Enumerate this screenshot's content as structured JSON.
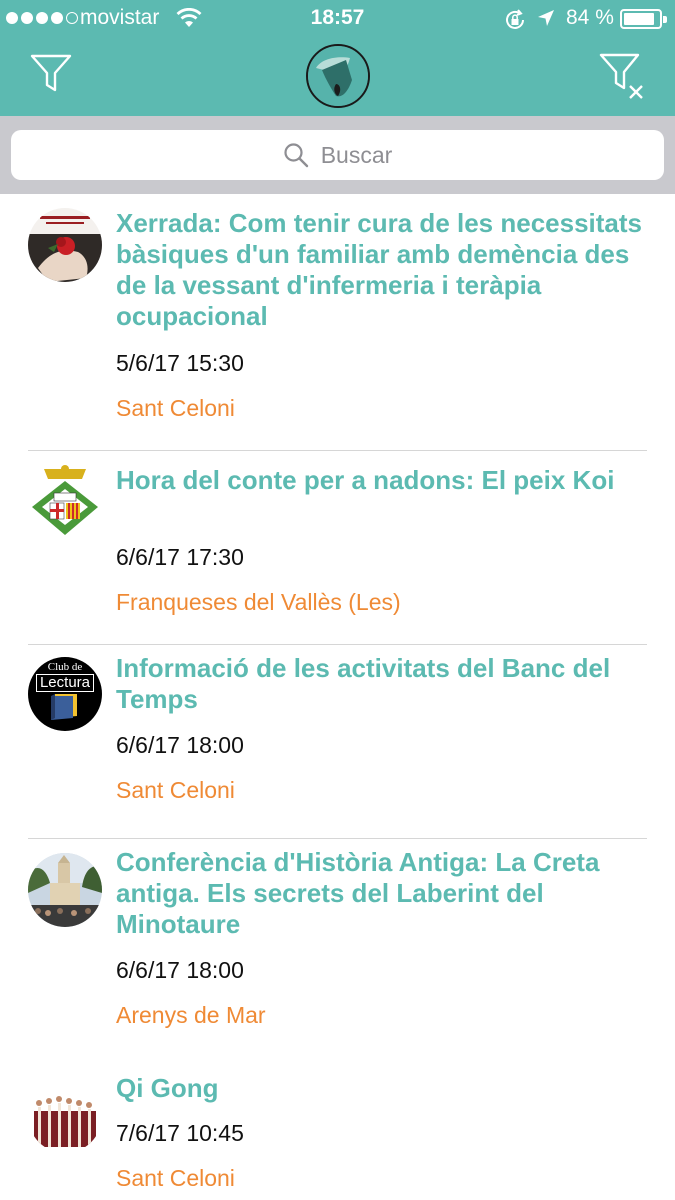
{
  "status_bar": {
    "carrier": "movistar",
    "time": "18:57",
    "battery": "84 %"
  },
  "colors": {
    "header_bg": "#5cbab1",
    "title": "#5cbab1",
    "place": "#ef8a35"
  },
  "header": {
    "left_icon": "filter-icon",
    "center_icon": "app-logo",
    "right_icon": "clear-filter-icon"
  },
  "search": {
    "placeholder": "Buscar"
  },
  "events": [
    {
      "title": "Xerrada: Com tenir cura de les necessitats bàsiques d'un familiar amb demència des de la vessant d'infermeria i teràpia ocupacional",
      "date": "5/6/17 15:30",
      "place": "Sant Celoni"
    },
    {
      "title": "Hora del conte per a nadons: El peix Koi",
      "date": "6/6/17 17:30",
      "place": "Franqueses del Vallès (Les)"
    },
    {
      "title": "Informació de les activitats del Banc del Temps",
      "date": "6/6/17 18:00",
      "place": "Sant Celoni",
      "thumb_text_1": "Club de",
      "thumb_text_2": "Lectura"
    },
    {
      "title": "Conferència d'Història Antiga: La Creta antiga. Els secrets del Laberint del Minotaure",
      "date": "6/6/17 18:00",
      "place": "Arenys de Mar"
    },
    {
      "title": "Qi Gong",
      "date": "7/6/17 10:45",
      "place": "Sant Celoni"
    }
  ]
}
